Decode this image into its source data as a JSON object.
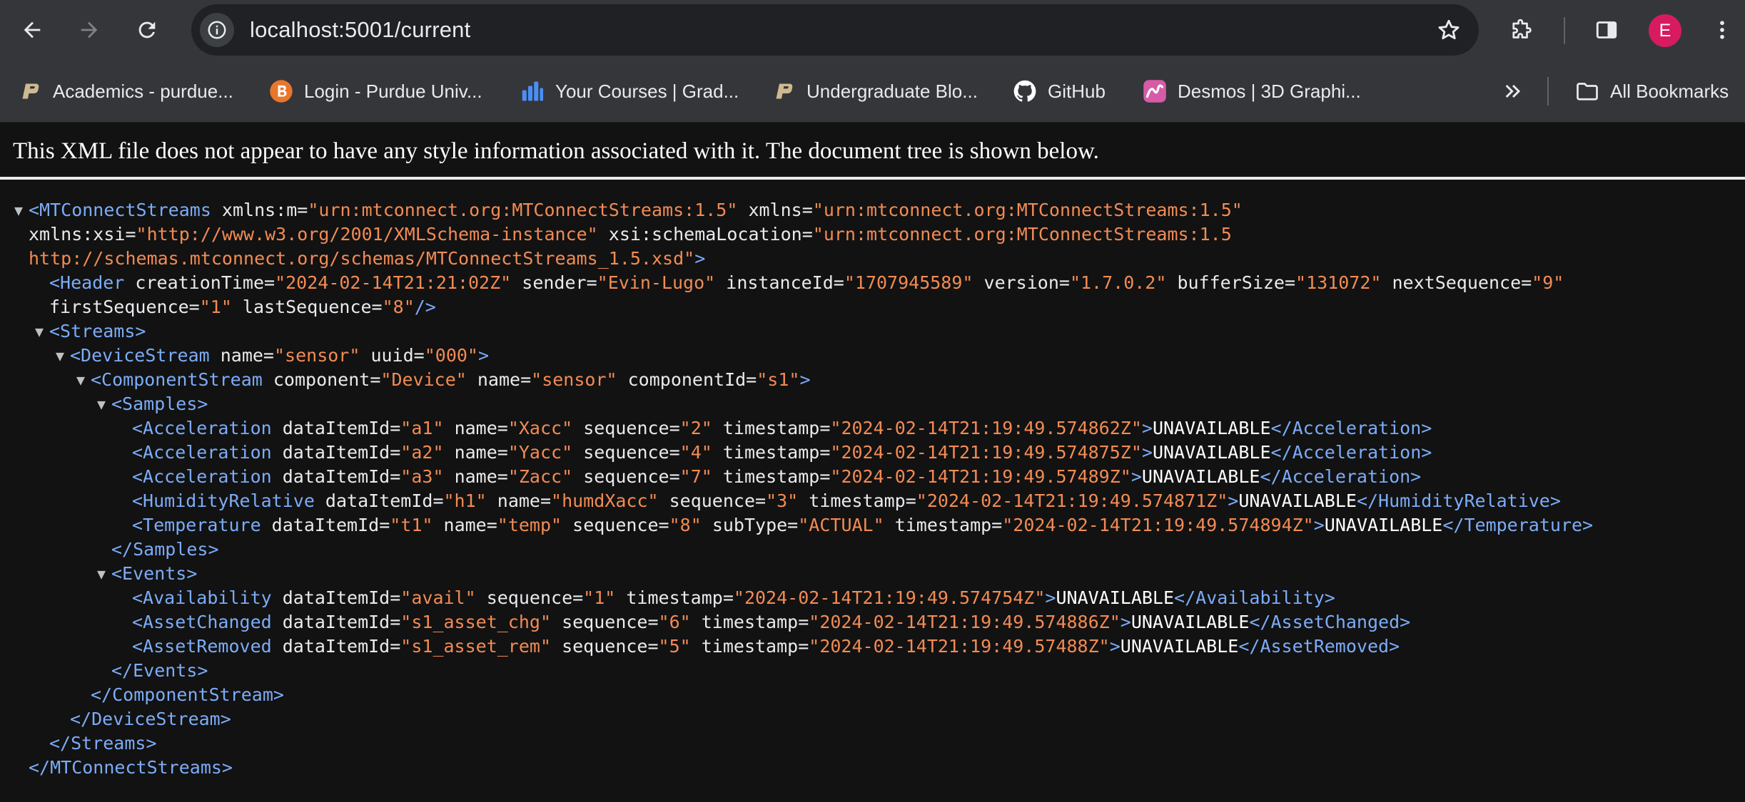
{
  "browser": {
    "url": "localhost:5001/current",
    "avatar_letter": "E",
    "accent_avatar": "#d81b60"
  },
  "bookmarks": [
    {
      "label": "Academics - purdue...",
      "icon": "purdue-p-icon"
    },
    {
      "label": "Login - Purdue Univ...",
      "icon": "brightspace-icon"
    },
    {
      "label": "Your Courses | Grad...",
      "icon": "gradescope-bars-icon"
    },
    {
      "label": "Undergraduate Blo...",
      "icon": "purdue-p-icon"
    },
    {
      "label": "GitHub",
      "icon": "github-icon"
    },
    {
      "label": "Desmos | 3D Graphi...",
      "icon": "desmos-icon"
    }
  ],
  "all_bookmarks_label": "All Bookmarks",
  "notice": "This XML file does not appear to have any style information associated with it. The document tree is shown below.",
  "xml": {
    "root": {
      "tag": "MTConnectStreams",
      "attrs": [
        [
          "xmlns:m",
          "urn:mtconnect.org:MTConnectStreams:1.5"
        ],
        [
          "xmlns",
          "urn:mtconnect.org:MTConnectStreams:1.5"
        ],
        [
          "xmlns:xsi",
          "http://www.w3.org/2001/XMLSchema-instance"
        ],
        [
          "xsi:schemaLocation",
          "urn:mtconnect.org:MTConnectStreams:1.5 http://schemas.mtconnect.org/schemas/MTConnectStreams_1.5.xsd"
        ]
      ]
    },
    "header": {
      "tag": "Header",
      "attrs": [
        [
          "creationTime",
          "2024-02-14T21:21:02Z"
        ],
        [
          "sender",
          "Evin-Lugo"
        ],
        [
          "instanceId",
          "1707945589"
        ],
        [
          "version",
          "1.7.0.2"
        ],
        [
          "bufferSize",
          "131072"
        ],
        [
          "nextSequence",
          "9"
        ],
        [
          "firstSequence",
          "1"
        ],
        [
          "lastSequence",
          "8"
        ]
      ]
    },
    "streams_tag": "Streams",
    "device_stream": {
      "tag": "DeviceStream",
      "attrs": [
        [
          "name",
          "sensor"
        ],
        [
          "uuid",
          "000"
        ]
      ]
    },
    "component_stream": {
      "tag": "ComponentStream",
      "attrs": [
        [
          "component",
          "Device"
        ],
        [
          "name",
          "sensor"
        ],
        [
          "componentId",
          "s1"
        ]
      ]
    },
    "samples_tag": "Samples",
    "samples": [
      {
        "tag": "Acceleration",
        "attrs": [
          [
            "dataItemId",
            "a1"
          ],
          [
            "name",
            "Xacc"
          ],
          [
            "sequence",
            "2"
          ],
          [
            "timestamp",
            "2024-02-14T21:19:49.574862Z"
          ]
        ],
        "text": "UNAVAILABLE"
      },
      {
        "tag": "Acceleration",
        "attrs": [
          [
            "dataItemId",
            "a2"
          ],
          [
            "name",
            "Yacc"
          ],
          [
            "sequence",
            "4"
          ],
          [
            "timestamp",
            "2024-02-14T21:19:49.574875Z"
          ]
        ],
        "text": "UNAVAILABLE"
      },
      {
        "tag": "Acceleration",
        "attrs": [
          [
            "dataItemId",
            "a3"
          ],
          [
            "name",
            "Zacc"
          ],
          [
            "sequence",
            "7"
          ],
          [
            "timestamp",
            "2024-02-14T21:19:49.57489Z"
          ]
        ],
        "text": "UNAVAILABLE"
      },
      {
        "tag": "HumidityRelative",
        "attrs": [
          [
            "dataItemId",
            "h1"
          ],
          [
            "name",
            "humdXacc"
          ],
          [
            "sequence",
            "3"
          ],
          [
            "timestamp",
            "2024-02-14T21:19:49.574871Z"
          ]
        ],
        "text": "UNAVAILABLE"
      },
      {
        "tag": "Temperature",
        "attrs": [
          [
            "dataItemId",
            "t1"
          ],
          [
            "name",
            "temp"
          ],
          [
            "sequence",
            "8"
          ],
          [
            "subType",
            "ACTUAL"
          ],
          [
            "timestamp",
            "2024-02-14T21:19:49.574894Z"
          ]
        ],
        "text": "UNAVAILABLE"
      }
    ],
    "events_tag": "Events",
    "events": [
      {
        "tag": "Availability",
        "attrs": [
          [
            "dataItemId",
            "avail"
          ],
          [
            "sequence",
            "1"
          ],
          [
            "timestamp",
            "2024-02-14T21:19:49.574754Z"
          ]
        ],
        "text": "UNAVAILABLE"
      },
      {
        "tag": "AssetChanged",
        "attrs": [
          [
            "dataItemId",
            "s1_asset_chg"
          ],
          [
            "sequence",
            "6"
          ],
          [
            "timestamp",
            "2024-02-14T21:19:49.574886Z"
          ]
        ],
        "text": "UNAVAILABLE"
      },
      {
        "tag": "AssetRemoved",
        "attrs": [
          [
            "dataItemId",
            "s1_asset_rem"
          ],
          [
            "sequence",
            "5"
          ],
          [
            "timestamp",
            "2024-02-14T21:19:49.57488Z"
          ]
        ],
        "text": "UNAVAILABLE"
      }
    ]
  }
}
